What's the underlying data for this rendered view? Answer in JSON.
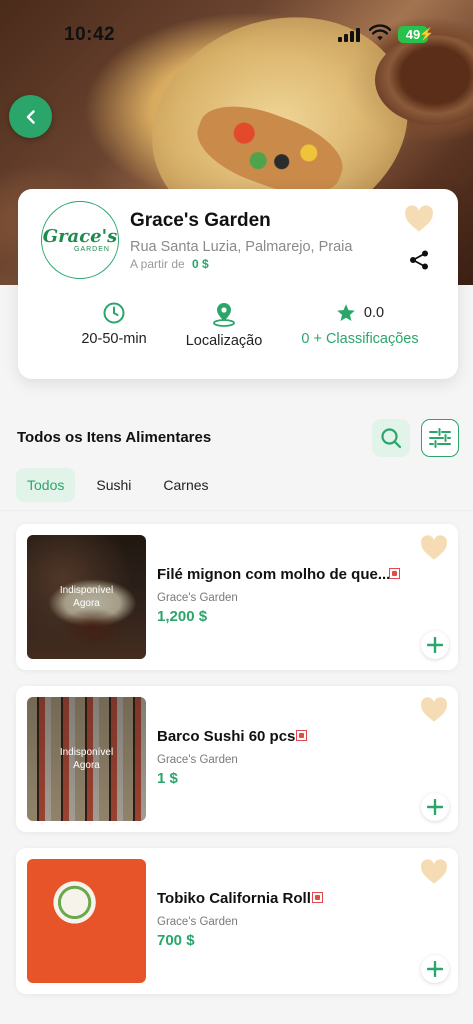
{
  "status_bar": {
    "time": "10:42",
    "battery": "49"
  },
  "restaurant": {
    "logo_main": "Grace's",
    "logo_sub": "GARDEN",
    "name": "Grace's Garden",
    "address": "Rua Santa Luzia, Palmarejo, Praia",
    "from_label": "A partir de",
    "from_price": "0 $",
    "delivery_time": "20-50-min",
    "location_label": "Localização",
    "rating": "0.0",
    "ratings_label": "0 + Classificações"
  },
  "section": {
    "title": "Todos os Itens Alimentares"
  },
  "tabs": [
    {
      "label": "Todos",
      "active": true
    },
    {
      "label": "Sushi",
      "active": false
    },
    {
      "label": "Carnes",
      "active": false
    }
  ],
  "items": [
    {
      "name": "Filé mignon com molho de que...",
      "restaurant": "Grace's Garden",
      "price": "1,200 $",
      "unavailable_line1": "Indisponível",
      "unavailable_line2": "Agora"
    },
    {
      "name": "Barco Sushi 60 pcs",
      "restaurant": "Grace's Garden",
      "price": "1 $",
      "unavailable_line1": "Indisponível",
      "unavailable_line2": "Agora"
    },
    {
      "name": "Tobiko California Roll",
      "restaurant": "Grace's Garden",
      "price": "700 $"
    }
  ],
  "colors": {
    "accent": "#2aa66a",
    "accent_light": "#e2f3e9",
    "heart": "#f6dcb5",
    "veg_marker": "#e24a4a"
  },
  "icons": [
    "back-arrow-icon",
    "heart-icon",
    "share-icon",
    "clock-icon",
    "location-pin-icon",
    "star-icon",
    "search-icon",
    "filter-sliders-icon",
    "plus-icon"
  ]
}
